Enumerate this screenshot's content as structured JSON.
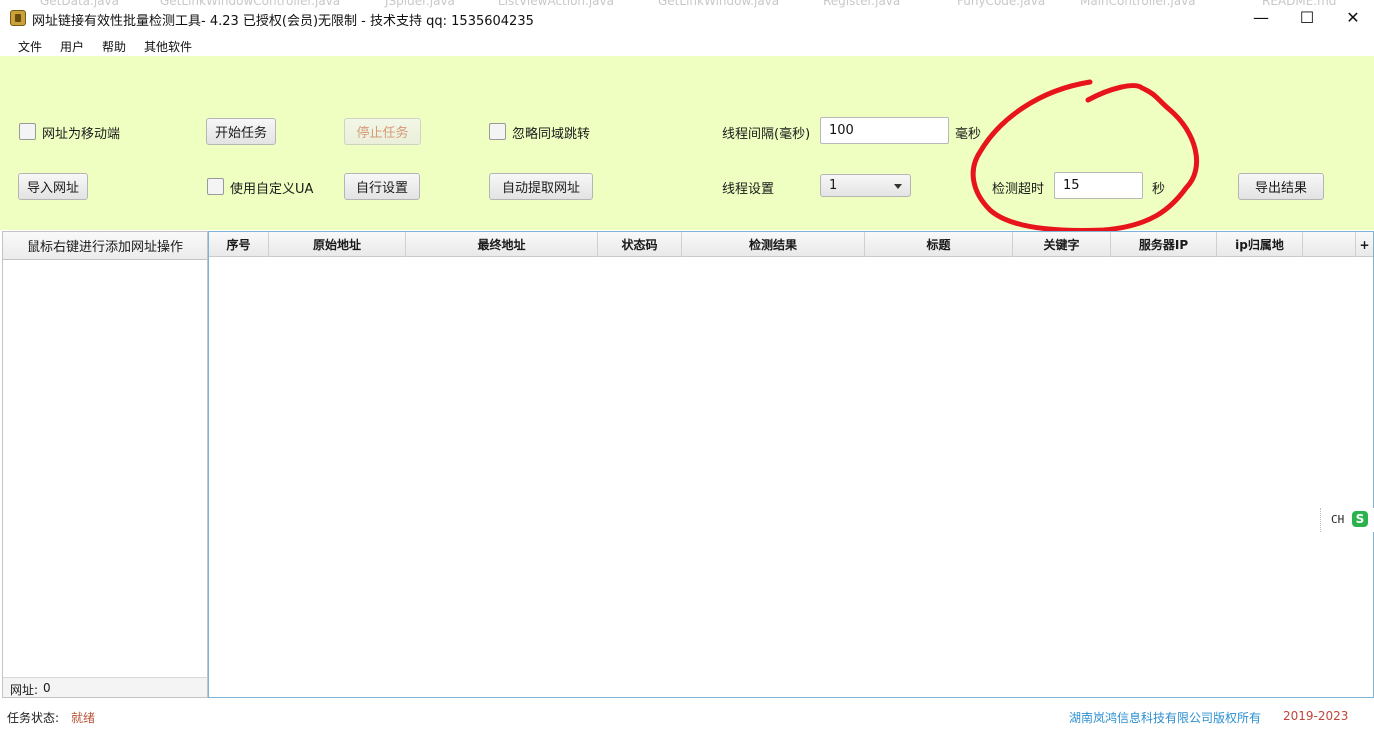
{
  "background_tabs": [
    "GetData.java",
    "GetLinkWindowController.java",
    "JSpider.java",
    "ListViewAction.java",
    "GetLinkWindow.java",
    "Register.java",
    "FunyCode.java",
    "MainController.java",
    "README.md"
  ],
  "window": {
    "title": "网址链接有效性批量检测工具-  4.23 已授权(会员)无限制 - 技术支持 qq: 1535604235",
    "minimize": "—",
    "maximize": "☐",
    "close": "✕"
  },
  "menu": [
    "文件",
    "用户",
    "帮助",
    "其他软件"
  ],
  "toolbar": {
    "mobile_checkbox_label": "网址为移动端",
    "import_button": "导入网址",
    "start_button": "开始任务",
    "custom_ua_label": "使用自定义UA",
    "stop_button": "停止任务",
    "custom_settings_button": "自行设置",
    "ignore_redirect_label": "忽略同域跳转",
    "auto_extract_button": "自动提取网址",
    "interval_label": "线程间隔(毫秒)",
    "interval_value": "100",
    "interval_unit": "毫秒",
    "thread_label": "线程设置",
    "thread_value": "1",
    "timeout_label": "检测超时",
    "timeout_value": "15",
    "timeout_unit": "秒",
    "export_button": "导出结果"
  },
  "left_panel": {
    "header": "鼠标右键进行添加网址操作",
    "count_label": "网址:",
    "count_value": "0"
  },
  "table": {
    "columns": [
      "序号",
      "原始地址",
      "最终地址",
      "状态码",
      "检测结果",
      "标题",
      "关键字",
      "服务器IP",
      "ip归属地"
    ],
    "add_column": "+",
    "rows": []
  },
  "ime": {
    "mode": "CH",
    "logo": "S"
  },
  "status": {
    "label": "任务状态:",
    "value": "就绪",
    "company": "湖南岚鸿信息科技有限公司版权所有",
    "years": "2019-2023"
  },
  "colors": {
    "toolbar_bg": "#efffc1",
    "annotation": "#e8141b",
    "status_value": "#b5553a",
    "company": "#2b8fd0",
    "years": "#c0453a",
    "ime_green": "#2bb24c"
  }
}
